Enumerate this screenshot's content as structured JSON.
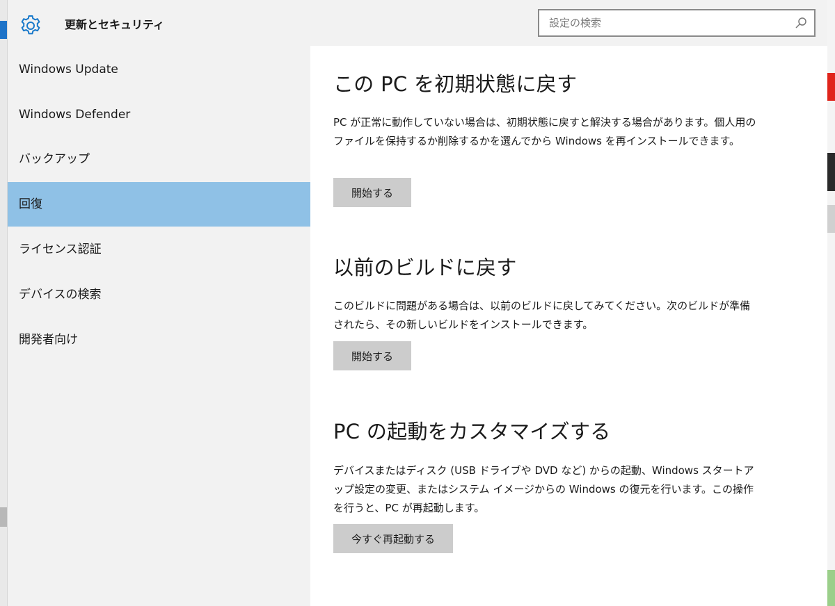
{
  "header": {
    "title": "更新とセキュリティ",
    "search_placeholder": "設定の検索",
    "icons": {
      "app": "gear-icon",
      "search": "search-icon"
    }
  },
  "sidebar": {
    "selected_index": 3,
    "items": [
      {
        "label": "Windows Update"
      },
      {
        "label": "Windows Defender"
      },
      {
        "label": "バックアップ"
      },
      {
        "label": "回復"
      },
      {
        "label": "ライセンス認証"
      },
      {
        "label": "デバイスの検索"
      },
      {
        "label": "開発者向け"
      }
    ]
  },
  "sections": [
    {
      "title": "この PC を初期状態に戻す",
      "description": "PC が正常に動作していない場合は、初期状態に戻すと解決する場合があります。個人用のファイルを保持するか削除するかを選んでから Windows を再インストールできます。",
      "button": "開始する"
    },
    {
      "title": "以前のビルドに戻す",
      "description": "このビルドに問題がある場合は、以前のビルドに戻してみてください。次のビルドが準備されたら、その新しいビルドをインストールできます。",
      "button": "開始する"
    },
    {
      "title": "PC の起動をカスタマイズする",
      "description": "デバイスまたはディスク (USB ドライブや DVD など) からの起動、Windows スタートアップ設定の変更、またはシステム イメージからの Windows の復元を行います。この操作を行うと、PC が再起動します。",
      "button": "今すぐ再起動する"
    }
  ],
  "colors": {
    "accent": "#1979ca",
    "selected_item_bg": "#8fc1e6",
    "sidebar_bg": "#f2f2f2",
    "button_bg": "#cccccc"
  }
}
